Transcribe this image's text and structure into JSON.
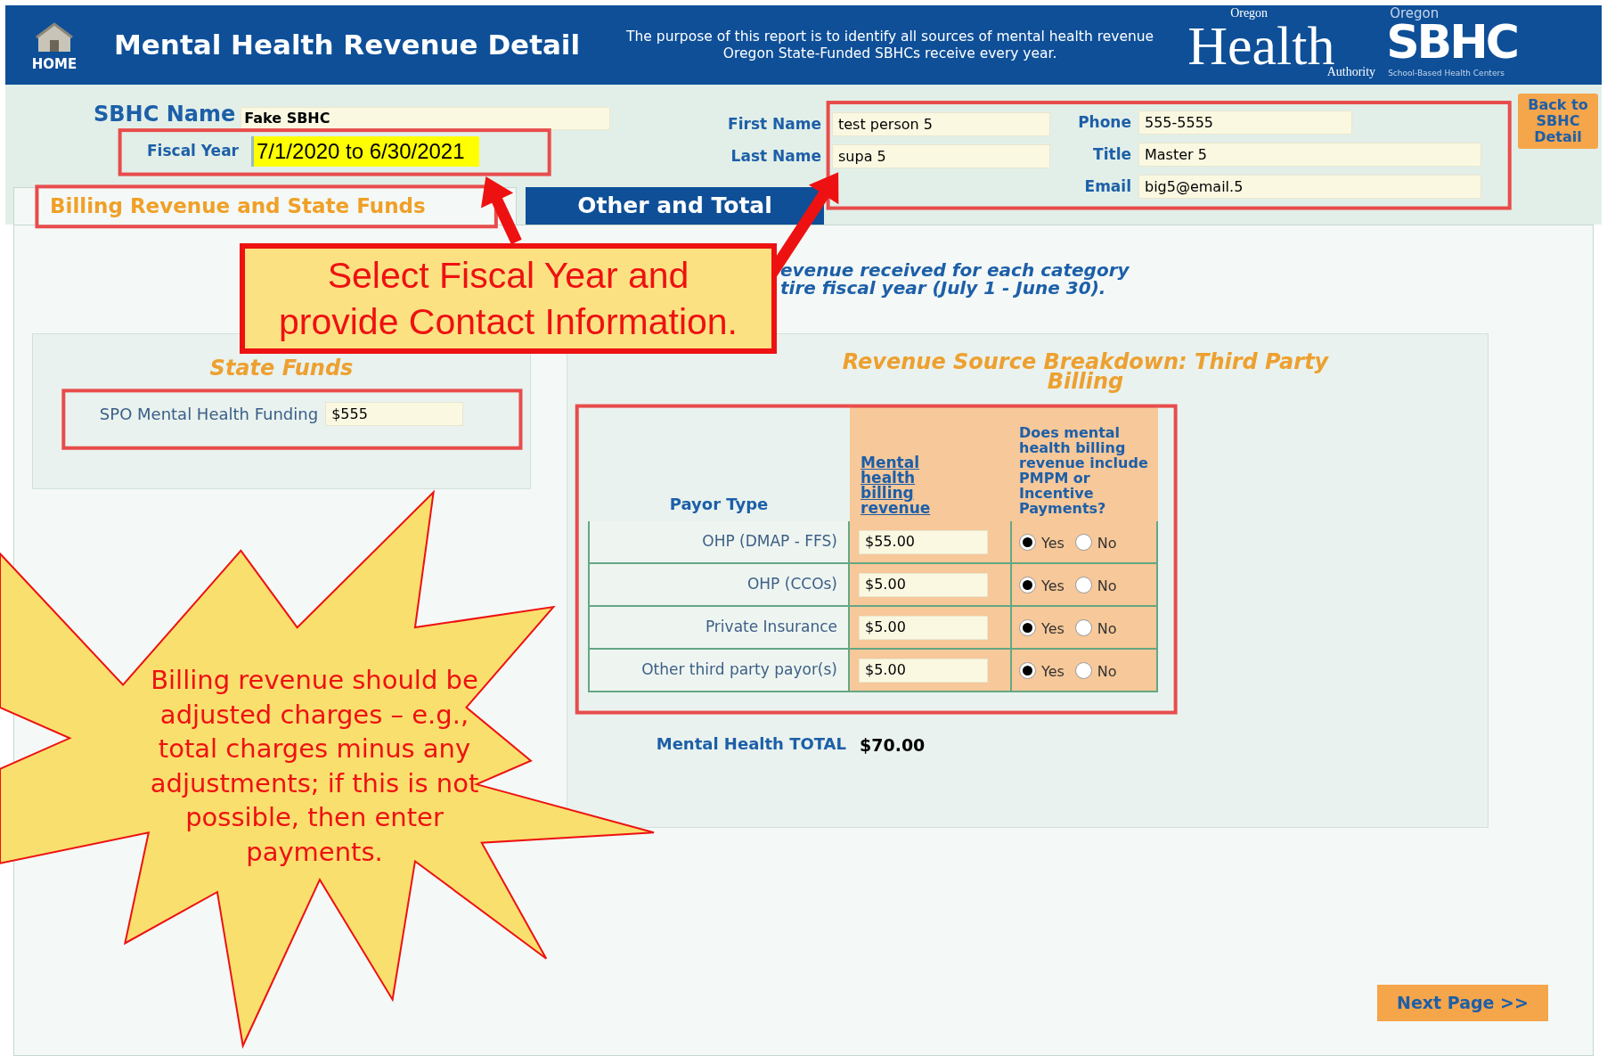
{
  "header": {
    "home_label": "HOME",
    "title": "Mental Health Revenue Detail",
    "description": "The purpose of this report is to identify all sources of mental health revenue Oregon State-Funded SBHCs receive every year.",
    "logo_oha": {
      "top": "Oregon",
      "main": "Health",
      "bottom": "Authority"
    },
    "logo_sbhc": {
      "top": "Oregon",
      "main": "SBHC",
      "bottom": "School-Based Health Centers"
    }
  },
  "form": {
    "sbhc_name": {
      "label": "SBHC Name",
      "value": "Fake SBHC"
    },
    "fiscal_year": {
      "label": "Fiscal Year",
      "value": "7/1/2020 to 6/30/2021"
    },
    "contact": [
      {
        "label": "First Name",
        "value": "test person 5"
      },
      {
        "label": "Last Name",
        "value": "supa 5"
      }
    ],
    "contact_right": [
      {
        "label": "Phone",
        "value": "555-5555"
      },
      {
        "label": "Title",
        "value": "Master 5"
      },
      {
        "label": "Email",
        "value": "big5@email.5"
      }
    ],
    "back_button": "Back to SBHC Detail"
  },
  "tabs": [
    {
      "label": "Billing Revenue and State Funds",
      "selected": true
    },
    {
      "label": "Other and Total",
      "selected": false
    }
  ],
  "instructions": [
    "evenue received  for each category",
    "tire fiscal year (July 1 - June 30)."
  ],
  "state_funds": {
    "title": "State Funds",
    "label": "SPO Mental Health Funding",
    "value": "$555"
  },
  "revenue": {
    "title": "Revenue Source Breakdown:  Third Party Billing",
    "columns": [
      "Payor Type",
      "Mental health billing revenue",
      "Does mental health billing revenue include PMPM or Incentive Payments?"
    ],
    "rows": [
      {
        "payor": "OHP (DMAP - FFS)",
        "revenue": "$55.00",
        "options": [
          {
            "label": "Yes",
            "selected": true
          },
          {
            "label": "No",
            "selected": false
          }
        ]
      },
      {
        "payor": "OHP (CCOs)",
        "revenue": "$5.00",
        "options": [
          {
            "label": "Yes",
            "selected": true
          },
          {
            "label": "No",
            "selected": false
          }
        ]
      },
      {
        "payor": "Private Insurance",
        "revenue": "$5.00",
        "options": [
          {
            "label": "Yes",
            "selected": true
          },
          {
            "label": "No",
            "selected": false
          }
        ]
      },
      {
        "payor": "Other third party payor(s)",
        "revenue": "$5.00",
        "options": [
          {
            "label": "Yes",
            "selected": true
          },
          {
            "label": "No",
            "selected": false
          }
        ]
      }
    ],
    "total_label": "Mental Health TOTAL",
    "total_value": "$70.00"
  },
  "next_button": "Next Page >>",
  "annotations": {
    "callout": [
      "Select Fiscal Year and",
      "provide Contact Information."
    ],
    "starburst": "Billing revenue should be adjusted charges – e.g., total charges minus any adjustments; if this is not possible, then enter payments."
  }
}
